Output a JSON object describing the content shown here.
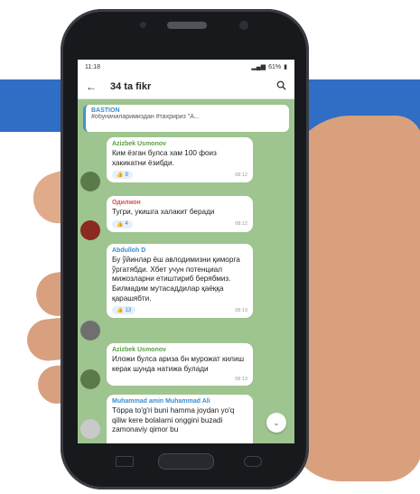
{
  "status_bar": {
    "time": "11:18",
    "battery": "61%"
  },
  "app_bar": {
    "title": "34 ta fikr",
    "back_icon": "arrow-left-icon",
    "search_icon": "search-icon"
  },
  "pinned": {
    "title": "BASTION",
    "text": "#обуначиларимиздан #тахририз \"A..."
  },
  "messages": [
    {
      "author": "Azizbek Usmonov",
      "author_color": "#5a9e45",
      "text": "Ким ёзган булса хам 100 фоиз хакикатни ёзибди.",
      "reaction": "9",
      "time": "08:12"
    },
    {
      "author": "Одилжон",
      "author_color": "#d9534f",
      "text": "Тугри, укишга халакит беради",
      "reaction": "4",
      "time": "08:12"
    },
    {
      "author": "Abdulloh D",
      "author_color": "#3b8ed0",
      "text": "Бу ўйинлар ёш авлодимизни қиморга ўргатябди. Хбет учун потенциал мижозларни етиштириб берябмиз. Билмадим мутасаддилар қаёққа қарашябти.",
      "reaction": "13",
      "time": "08:13"
    },
    {
      "author": "Azizbek Usmonov",
      "author_color": "#5a9e45",
      "text": "Иложи булса ариза бн мурожат килиш керак шунда натижа булади",
      "reaction": "",
      "time": "08:13"
    },
    {
      "author": "Muhammad amin Muhammad Ali",
      "author_color": "#3b8ed0",
      "text": "Tӧрра tо'g'ri buni hamma joydan yо'q qiliw kere bolalarni onggini buzadi zamonaviy qimor bu",
      "reaction": "",
      "time": ""
    }
  ]
}
